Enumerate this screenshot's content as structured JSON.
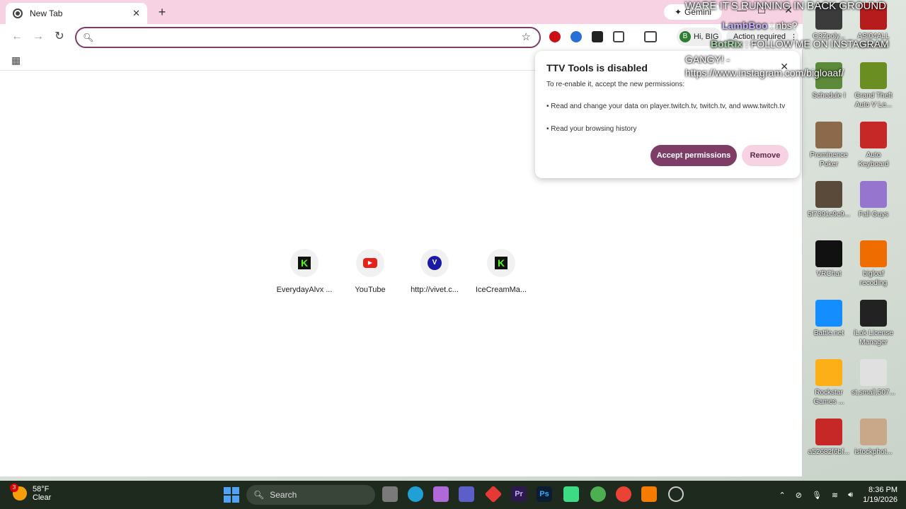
{
  "browser": {
    "tab_title": "New Tab",
    "tab_close": "✕",
    "new_tab": "+",
    "gemini_label": "Gemini",
    "window_min": "—",
    "window_max": "☐",
    "window_close": "✕"
  },
  "toolbar": {
    "back": "←",
    "forward": "→",
    "reload": "↻",
    "omnibox_value": "",
    "omnibox_placeholder": "",
    "profile_initial": "B",
    "profile_label": "Hi, BIG",
    "action_required": "Action required",
    "action_more": "⋮"
  },
  "shortcuts": [
    {
      "label": "EverydayAlvx ...",
      "icon": "kick-icon",
      "glyph": "K"
    },
    {
      "label": "YouTube",
      "icon": "youtube-icon",
      "glyph": "▶"
    },
    {
      "label": "http://vivet.c...",
      "icon": "vivet-icon",
      "glyph": "V"
    },
    {
      "label": "IceCreamMa...",
      "icon": "kick-icon",
      "glyph": "K"
    }
  ],
  "popup": {
    "title": "TTV Tools is disabled",
    "intro": "To re-enable it, accept the new permissions:",
    "perm1": "• Read and change your data on player.twitch.tv, twitch.tv, and www.twitch.tv",
    "perm2": "• Read your browsing history",
    "accept": "Accept permissions",
    "remove": "Remove",
    "close": "✕"
  },
  "desktop_icons": [
    {
      "label": "G3Zpoly...",
      "color": "#3b3b3b"
    },
    {
      "label": "ASI04ALL Web Site",
      "color": "#b71c1c"
    },
    {
      "label": "Schedule I",
      "color": "#5d8a3a"
    },
    {
      "label": "Grand Theft Auto V Le...",
      "color": "#6b8e23"
    },
    {
      "label": "Prominence Poker",
      "color": "#8a6a4a"
    },
    {
      "label": "Auto Keyboard",
      "color": "#c62828"
    },
    {
      "label": "5f7391c9c9...",
      "color": "#5a4a3a"
    },
    {
      "label": "Fall Guys",
      "color": "#9575cd"
    },
    {
      "label": "VRChat",
      "color": "#111111"
    },
    {
      "label": "bigloaf recoding",
      "color": "#ef6c00"
    },
    {
      "label": "Battle.net",
      "color": "#148eff"
    },
    {
      "label": "iLok License Manager",
      "color": "#222222"
    },
    {
      "label": "Rockstar Games ...",
      "color": "#fcaf17"
    },
    {
      "label": "st,small,507...",
      "color": "#e0e0e0"
    },
    {
      "label": "a52682f6bf...",
      "color": "#c62828"
    },
    {
      "label": "istockphot...",
      "color": "#c9a88a"
    }
  ],
  "overlay": {
    "line1": "WARE IT'S RUNNING IN BACK GROUND",
    "user1": "LambBoo",
    "msg1": ": nbs?",
    "user2": "BotRix",
    "msg2": ": FOLLOW ME ON INSTAGRAM",
    "msg3": "GANGY! -",
    "msg4": "https://www.instagram.com/bigloaaf/"
  },
  "taskbar": {
    "temp": "58°F",
    "condition": "Clear",
    "weather_badge": "3",
    "search_label": "Search",
    "time": "8:36 PM",
    "date": "1/19/2026"
  }
}
